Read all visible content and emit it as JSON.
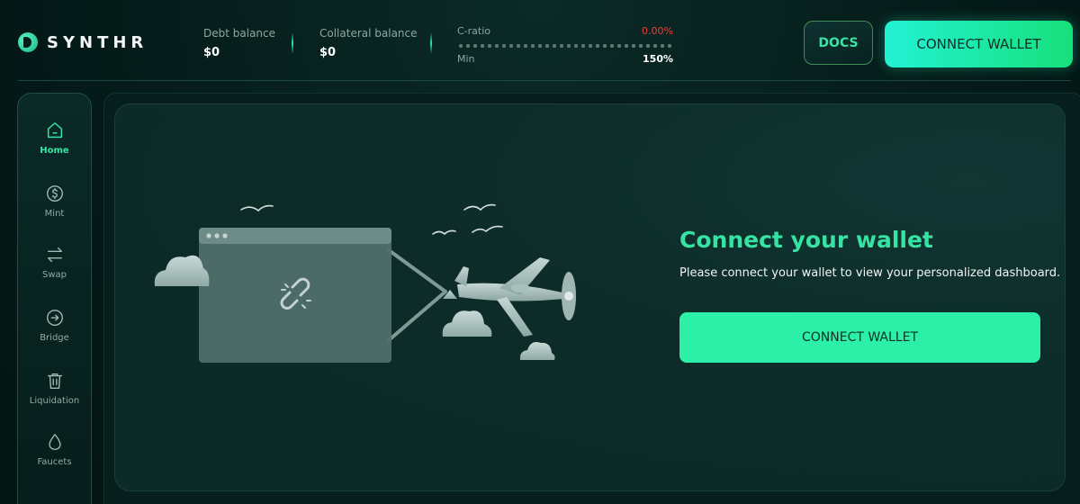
{
  "brand": {
    "name": "SYNTHR"
  },
  "header": {
    "debt_balance": {
      "label": "Debt balance",
      "value": "$0"
    },
    "collateral_balance": {
      "label": "Collateral balance",
      "value": "$0"
    },
    "c_ratio": {
      "label": "C-ratio",
      "value": "0.00%",
      "min_label": "Min",
      "max_value": "150%"
    },
    "docs_label": "DOCS",
    "connect_label": "CONNECT WALLET"
  },
  "sidebar": {
    "items": [
      {
        "label": "Home",
        "icon": "home-icon",
        "active": true
      },
      {
        "label": "Mint",
        "icon": "dollar-coin-icon",
        "active": false
      },
      {
        "label": "Swap",
        "icon": "swap-arrows-icon",
        "active": false
      },
      {
        "label": "Bridge",
        "icon": "arrow-right-circle-icon",
        "active": false
      },
      {
        "label": "Liquidation",
        "icon": "trash-icon",
        "active": false
      },
      {
        "label": "Faucets",
        "icon": "droplet-icon",
        "active": false
      }
    ]
  },
  "main": {
    "title": "Connect your wallet",
    "subtitle": "Please connect your wallet to view your personalized dashboard.",
    "connect_label": "CONNECT WALLET"
  },
  "colors": {
    "accent": "#36e3a3",
    "button_green": "#2cf0a8",
    "danger": "#e8413d",
    "background": "#041c1a"
  }
}
